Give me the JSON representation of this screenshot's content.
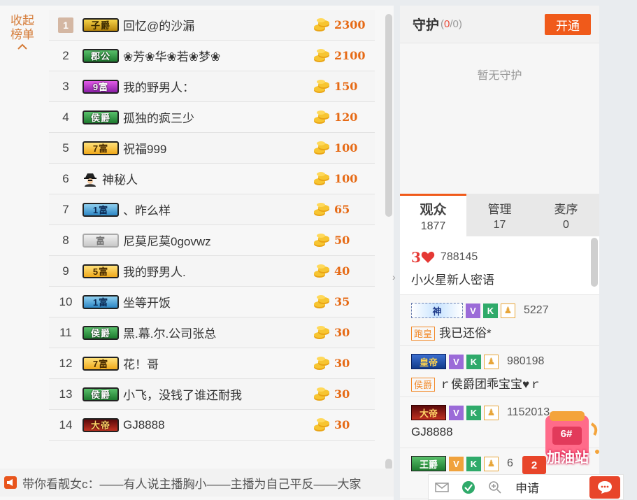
{
  "collapse": {
    "line1": "收起",
    "line2": "榜单"
  },
  "ranking": [
    {
      "rank": "1",
      "badge": "子爵",
      "badge_style": "gold",
      "name": "回忆@的沙漏",
      "score": "2300"
    },
    {
      "rank": "2",
      "badge": "郡公",
      "badge_style": "green",
      "name": "❀芳❀华❀若❀梦❀",
      "score": "2100"
    },
    {
      "rank": "3",
      "badge": "9富",
      "badge_style": "purple",
      "name": "我的野男人：",
      "score": "150"
    },
    {
      "rank": "4",
      "badge": "侯爵",
      "badge_style": "green",
      "name": "孤独的疯三少",
      "score": "120"
    },
    {
      "rank": "5",
      "badge": "7富",
      "badge_style": "yellow",
      "name": "祝福999",
      "score": "100"
    },
    {
      "rank": "6",
      "badge": "",
      "badge_style": "mystery",
      "name": "神秘人",
      "score": "100"
    },
    {
      "rank": "7",
      "badge": "1富",
      "badge_style": "blue",
      "name": "、昨么样",
      "score": "65"
    },
    {
      "rank": "8",
      "badge": "富",
      "badge_style": "gray",
      "name": "尼莫尼莫0govwz",
      "score": "50"
    },
    {
      "rank": "9",
      "badge": "5富",
      "badge_style": "yellow",
      "name": "我的野男人.",
      "score": "40"
    },
    {
      "rank": "10",
      "badge": "1富",
      "badge_style": "blue",
      "name": "坐等开饭",
      "score": "35"
    },
    {
      "rank": "11",
      "badge": "侯爵",
      "badge_style": "green",
      "name": "黑.幕.尔.公司张总",
      "score": "30"
    },
    {
      "rank": "12",
      "badge": "7富",
      "badge_style": "yellow",
      "name": "花！哥",
      "score": "30"
    },
    {
      "rank": "13",
      "badge": "侯爵",
      "badge_style": "green",
      "name": "小飞，没钱了谁还耐我",
      "score": "30"
    },
    {
      "rank": "14",
      "badge": "大帝",
      "badge_style": "red",
      "name": "GJ8888",
      "score": "30"
    }
  ],
  "ticker": "带你看靓女c：——有人说主播胸小——主播为自己平反——大家",
  "guard": {
    "title": "守护",
    "count_open": "(",
    "count_current": "0",
    "count_total": "/0)",
    "open_button": "开通",
    "empty": "暂无守护"
  },
  "tabs": [
    {
      "label": "观众",
      "count": "1877",
      "active": true
    },
    {
      "label": "管理",
      "count": "17",
      "active": false
    },
    {
      "label": "麦序",
      "count": "0",
      "active": false
    }
  ],
  "audience": [
    {
      "level": "3",
      "id": "788145",
      "message": "小火星新人密语"
    },
    {
      "badge": "神",
      "id": "5227",
      "tag": "跑皇",
      "message": "我已还俗*"
    },
    {
      "badge": "皇帝",
      "id": "980198",
      "tag": "侯爵",
      "message": "ｒ侯爵团乖宝宝♥ｒ"
    },
    {
      "badge": "大帝",
      "id": "1152013",
      "tag": "",
      "message": "GJ8888"
    },
    {
      "badge": "王爵",
      "id": "6",
      "tag": "",
      "message": ""
    }
  ],
  "bottom": {
    "apply": "申请",
    "notification": "2"
  },
  "promo": {
    "label": "加油站",
    "number": "6#"
  }
}
